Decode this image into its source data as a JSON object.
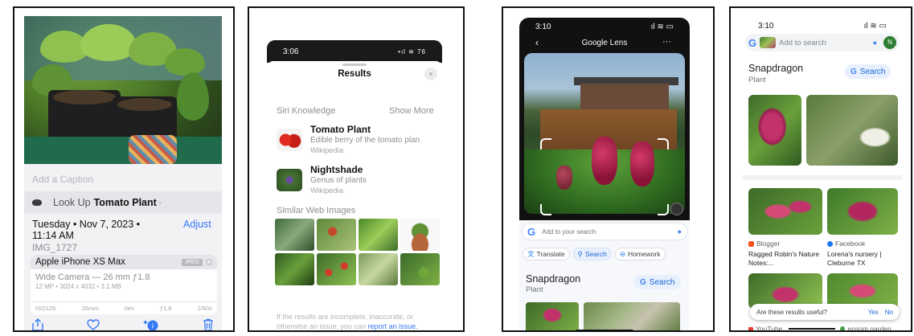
{
  "photos_info": {
    "caption_placeholder": "Add a Caption",
    "lookup_prefix": "Look Up",
    "lookup_subject": "Tomato Plant",
    "lookup_chevron": "›",
    "date_line1": "Tuesday • Nov 7, 2023 •",
    "date_line2": "11:14 AM",
    "adjust_label": "Adjust",
    "filename": "IMG_1727",
    "device": "Apple iPhone XS Max",
    "format_badge": "JPEG",
    "lens": "Wide Camera — 26 mm ƒ1.8",
    "spec": "12 MP • 3024 x 4032 • 3.1 MB",
    "exif": [
      "ISO125",
      "26mm",
      "0ev",
      "ƒ1.8",
      "1/60s"
    ],
    "toolbar_icons": [
      "share-icon",
      "heart-icon",
      "info-sparkle-icon",
      "trash-icon"
    ]
  },
  "siri_results": {
    "time": "3:06",
    "status_icons": "•ıl ≋ 76",
    "title": "Results",
    "close": "×",
    "section_knowledge": "Siri Knowledge",
    "show_more": "Show More",
    "items": [
      {
        "name": "Tomato Plant",
        "desc": "Edible berry of the tomato plan",
        "source": "Wikipedia"
      },
      {
        "name": "Nightshade",
        "desc": "Genus of plants",
        "source": "Wikipedia"
      }
    ],
    "section_images": "Similar Web Images",
    "note_text": "If the results are incomplete, inaccurate, or otherwise an issue, you can",
    "note_link": "report an issue."
  },
  "google_lens": {
    "time": "3:10",
    "status_icons": "ıl ≋ ▭",
    "title": "Google Lens",
    "back": "‹",
    "more": "···",
    "search_placeholder": "Add to your search",
    "chips": [
      "Translate",
      "Search",
      "Homework"
    ],
    "result_name": "Snapdragon",
    "result_type": "Plant",
    "result_button": "Search"
  },
  "google_results": {
    "time": "3:10",
    "status_icons": "ıl ≋ ▭",
    "search_placeholder": "Add to search",
    "avatar": "N",
    "result_name": "Snapdragon",
    "result_type": "Plant",
    "result_button": "Search",
    "cards": [
      {
        "source": "Blogger",
        "caption": "Ragged Robin's Nature Notes:..."
      },
      {
        "source": "Facebook",
        "caption": "Lorena's nursery | Cleburne TX"
      }
    ],
    "feedback_question": "Are these results useful?",
    "feedback_yes": "Yes",
    "feedback_no": "No",
    "footer_left": "YouTube",
    "footer_right": "epsom.garden"
  },
  "colors": {
    "ios_blue": "#3478f6",
    "google_blue": "#4285f4",
    "chip_blue": "#1967d2"
  }
}
